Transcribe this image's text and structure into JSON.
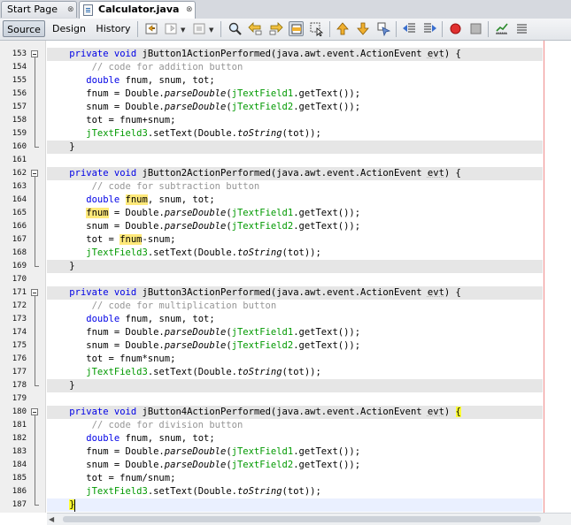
{
  "tabs": [
    {
      "label": "Start Page",
      "close": "⊗"
    },
    {
      "label": "Calculator.java",
      "close": "⊗"
    }
  ],
  "toolbar": {
    "views": [
      "Source",
      "Design",
      "History"
    ],
    "icons": [
      "back-icon",
      "forward-icon",
      "history-icon",
      "find-icon",
      "find-previous-icon",
      "find-next-icon",
      "toggle-highlight-icon",
      "select-icon",
      "previous-bookmark-icon",
      "next-bookmark-icon",
      "toggle-bookmark-icon",
      "shift-left-icon",
      "shift-right-icon",
      "record-macro-icon",
      "stop-macro-icon",
      "chart-icon",
      "comment-icon"
    ]
  },
  "editor": {
    "lines": [
      {
        "num": "153",
        "fold": "start",
        "cls": "hl",
        "html": "    <span class=\"kw\">private</span> <span class=\"kw\">void</span> jButton1ActionPerformed(java.awt.event.ActionEvent <span class=\"uline\">evt</span>) {"
      },
      {
        "num": "154",
        "cls": "",
        "html": "        <span class=\"cm\">// code for addition button</span>"
      },
      {
        "num": "155",
        "cls": "",
        "html": "       <span class=\"kw\">double</span> fnum, snum, tot;"
      },
      {
        "num": "156",
        "cls": "",
        "html": "       fnum = Double.<span class=\"it\">parseDouble</span>(<span class=\"fld\">jTextField1</span>.getText());"
      },
      {
        "num": "157",
        "cls": "",
        "html": "       snum = Double.<span class=\"it\">parseDouble</span>(<span class=\"fld\">jTextField2</span>.getText());"
      },
      {
        "num": "158",
        "cls": "",
        "html": "       tot = fnum+snum;"
      },
      {
        "num": "159",
        "cls": "",
        "html": "       <span class=\"fld\">jTextField3</span>.setText(Double.<span class=\"it\">toString</span>(tot));"
      },
      {
        "num": "160",
        "fold": "end",
        "cls": "hl",
        "html": "    }"
      },
      {
        "num": "161",
        "cls": "",
        "html": ""
      },
      {
        "num": "162",
        "fold": "start",
        "cls": "hl",
        "html": "    <span class=\"kw\">private</span> <span class=\"kw\">void</span> jButton2ActionPerformed(java.awt.event.ActionEvent <span class=\"uline\">evt</span>) {"
      },
      {
        "num": "163",
        "cls": "",
        "html": "        <span class=\"cm\">// code for subtraction button</span>"
      },
      {
        "num": "164",
        "cls": "",
        "html": "       <span class=\"kw\">double</span> <span class=\"mark\">fnum</span>, snum, tot;"
      },
      {
        "num": "165",
        "cls": "",
        "html": "       <span class=\"mark\">fnum</span> = Double.<span class=\"it\">parseDouble</span>(<span class=\"fld\">jTextField1</span>.getText());"
      },
      {
        "num": "166",
        "cls": "",
        "html": "       snum = Double.<span class=\"it\">parseDouble</span>(<span class=\"fld\">jTextField2</span>.getText());"
      },
      {
        "num": "167",
        "cls": "",
        "html": "       tot = <span class=\"mark\">fnum</span>-snum;"
      },
      {
        "num": "168",
        "cls": "",
        "html": "       <span class=\"fld\">jTextField3</span>.setText(Double.<span class=\"it\">toString</span>(tot));"
      },
      {
        "num": "169",
        "fold": "end",
        "cls": "hl",
        "html": "    }"
      },
      {
        "num": "170",
        "cls": "",
        "html": ""
      },
      {
        "num": "171",
        "fold": "start",
        "cls": "hl",
        "html": "    <span class=\"kw\">private</span> <span class=\"kw\">void</span> jButton3ActionPerformed(java.awt.event.ActionEvent <span class=\"uline\">evt</span>) {"
      },
      {
        "num": "172",
        "cls": "",
        "html": "        <span class=\"cm\">// code for multiplication button</span>"
      },
      {
        "num": "173",
        "cls": "",
        "html": "       <span class=\"kw\">double</span> fnum, snum, tot;"
      },
      {
        "num": "174",
        "cls": "",
        "html": "       fnum = Double.<span class=\"it\">parseDouble</span>(<span class=\"fld\">jTextField1</span>.getText());"
      },
      {
        "num": "175",
        "cls": "",
        "html": "       snum = Double.<span class=\"it\">parseDouble</span>(<span class=\"fld\">jTextField2</span>.getText());"
      },
      {
        "num": "176",
        "cls": "",
        "html": "       tot = fnum*snum;"
      },
      {
        "num": "177",
        "cls": "",
        "html": "       <span class=\"fld\">jTextField3</span>.setText(Double.<span class=\"it\">toString</span>(tot));"
      },
      {
        "num": "178",
        "fold": "end",
        "cls": "hl",
        "html": "    }"
      },
      {
        "num": "179",
        "cls": "",
        "html": ""
      },
      {
        "num": "180",
        "fold": "start",
        "cls": "hl",
        "html": "    <span class=\"kw\">private</span> <span class=\"kw\">void</span> jButton4ActionPerformed(java.awt.event.ActionEvent <span class=\"uline\">evt</span>) <span class=\"brace\">{</span>"
      },
      {
        "num": "181",
        "cls": "",
        "html": "        <span class=\"cm\">// code for division button</span>"
      },
      {
        "num": "182",
        "cls": "",
        "html": "       <span class=\"kw\">double</span> fnum, snum, tot;"
      },
      {
        "num": "183",
        "cls": "",
        "html": "       fnum = Double.<span class=\"it\">parseDouble</span>(<span class=\"fld\">jTextField1</span>.getText());"
      },
      {
        "num": "184",
        "cls": "",
        "html": "       snum = Double.<span class=\"it\">parseDouble</span>(<span class=\"fld\">jTextField2</span>.getText());"
      },
      {
        "num": "185",
        "cls": "",
        "html": "       tot = fnum/snum;"
      },
      {
        "num": "186",
        "cls": "",
        "html": "       <span class=\"fld\">jTextField3</span>.setText(Double.<span class=\"it\">toString</span>(tot));"
      },
      {
        "num": "187",
        "fold": "end",
        "cls": "cur",
        "html": "    <span class=\"brace\">}</span>"
      }
    ]
  },
  "colors": {
    "keyword": "#0000e6",
    "comment": "#969696",
    "field": "#009900",
    "current_line": "#eaf0ff",
    "method_highlight": "#e6e6e6",
    "mark_occurrence": "#ffe97a",
    "brace_match": "#ffff33",
    "margin_line": "#ef8a8a"
  }
}
